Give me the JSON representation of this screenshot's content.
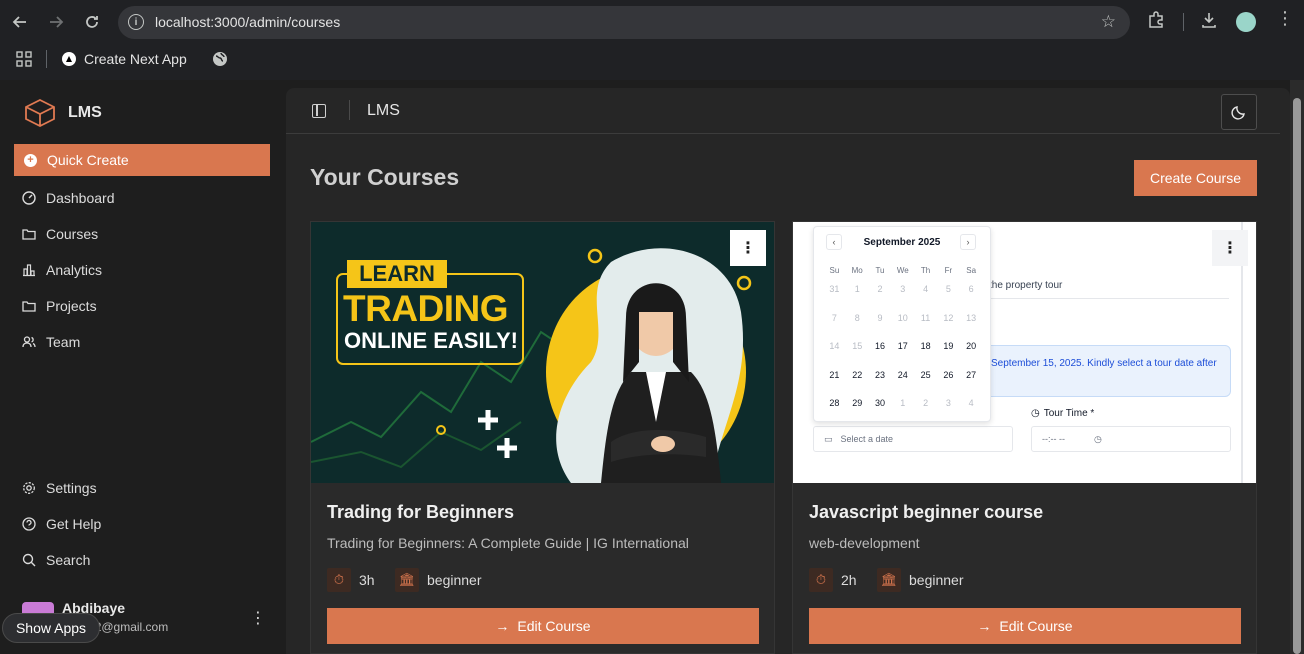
{
  "browser": {
    "url": "localhost:3000/admin/courses",
    "bookmark_label": "Create Next App"
  },
  "sidebar": {
    "brand": "LMS",
    "quick_create": "Quick Create",
    "items": [
      {
        "label": "Dashboard",
        "icon": "dashboard-icon"
      },
      {
        "label": "Courses",
        "icon": "folder-icon"
      },
      {
        "label": "Analytics",
        "icon": "chart-icon"
      },
      {
        "label": "Projects",
        "icon": "folder-icon"
      },
      {
        "label": "Team",
        "icon": "users-icon"
      }
    ],
    "bottom_items": [
      {
        "label": "Settings",
        "icon": "gear-icon"
      },
      {
        "label": "Get Help",
        "icon": "help-icon"
      },
      {
        "label": "Search",
        "icon": "search-icon"
      }
    ],
    "user": {
      "name": "Abdibaye",
      "email": "ye0902@gmail.com"
    }
  },
  "overlay": {
    "show_apps": "Show Apps"
  },
  "header": {
    "title": "LMS"
  },
  "main": {
    "title": "Your Courses",
    "create_button": "Create Course"
  },
  "courses": [
    {
      "title": "Trading for Beginners",
      "description": "Trading for Beginners: A Complete Guide | IG International",
      "duration": "3h",
      "level": "beginner",
      "edit_label": "Edit Course",
      "thumb": {
        "line1": "LEARN",
        "line2": "TRADING",
        "line3": "ONLINE EASILY!"
      }
    },
    {
      "title": "Javascript beginner course",
      "description": "web-development",
      "duration": "2h",
      "level": "beginner",
      "edit_label": "Edit Course",
      "thumb": {
        "month": "September 2025",
        "weekdays": [
          "Su",
          "Mo",
          "Tu",
          "We",
          "Th",
          "Fr",
          "Sa"
        ],
        "days": [
          "31",
          "1",
          "2",
          "3",
          "4",
          "5",
          "6",
          "7",
          "8",
          "9",
          "10",
          "11",
          "12",
          "13",
          "14",
          "15",
          "16",
          "17",
          "18",
          "19",
          "20",
          "21",
          "22",
          "23",
          "24",
          "25",
          "26",
          "27",
          "28",
          "29",
          "30",
          "1",
          "2",
          "3",
          "4"
        ],
        "text_tour": "the property tour",
        "text_notice": "September 15, 2025. Kindly select a tour date after",
        "tour_time_label": "Tour Time *",
        "date_placeholder": "Select a date",
        "time_placeholder": "--:-- --"
      }
    }
  ],
  "colors": {
    "accent": "#d9774f",
    "background": "#1e1e1e",
    "panel": "#262626"
  }
}
